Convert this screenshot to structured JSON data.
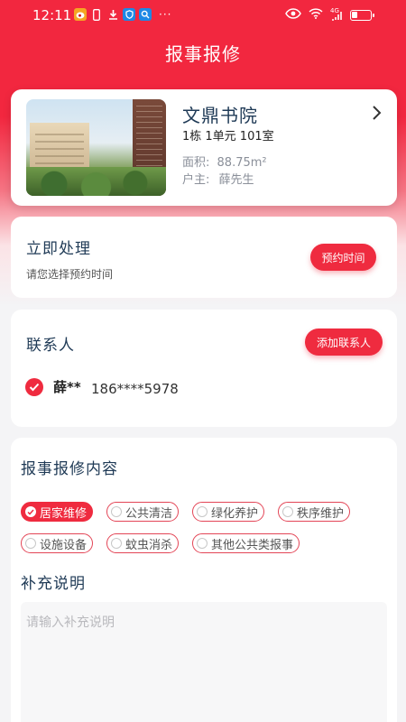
{
  "statusbar": {
    "time": "12:11",
    "left_icons": [
      "weibo-icon",
      "phone-icon",
      "download-icon",
      "shield-icon",
      "search-icon"
    ],
    "right_icons": [
      "eye-icon",
      "wifi-icon",
      "signal-icon",
      "battery-icon"
    ],
    "dots": "···",
    "network_badge": "4G"
  },
  "header": {
    "title": "报事报修"
  },
  "house": {
    "name": "文鼎书院",
    "unit": "1栋 1单元 101室",
    "area_label": "面积:",
    "area_value": "88.75m²",
    "owner_label": "户主:",
    "owner_value": "薛先生"
  },
  "schedule": {
    "title": "立即处理",
    "subtitle": "请您选择预约时间",
    "button": "预约时间"
  },
  "contacts": {
    "title": "联系人",
    "add_button": "添加联系人",
    "items": [
      {
        "name": "薛**",
        "phone": "186****5978",
        "selected": true
      }
    ]
  },
  "content": {
    "title": "报事报修内容",
    "tags": [
      {
        "label": "居家维修",
        "selected": true
      },
      {
        "label": "公共清洁",
        "selected": false
      },
      {
        "label": "绿化养护",
        "selected": false
      },
      {
        "label": "秩序维护",
        "selected": false
      },
      {
        "label": "设施设备",
        "selected": false
      },
      {
        "label": "蚊虫消杀",
        "selected": false
      },
      {
        "label": "其他公共类报事",
        "selected": false
      }
    ],
    "remark_title": "补充说明",
    "remark_placeholder": "请输入补充说明"
  },
  "colors": {
    "primary": "#ef2b3f",
    "header_red": "#f2273f",
    "title_text": "#1f3a56",
    "muted_text": "#8a8f99"
  }
}
